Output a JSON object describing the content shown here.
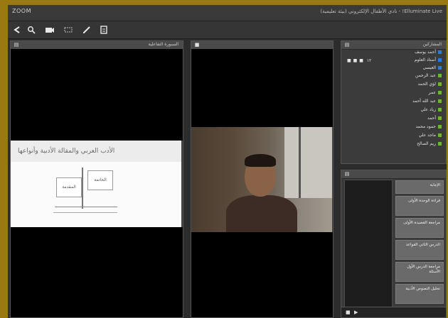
{
  "app": {
    "logo": "ZOOM",
    "title": "Elluminate Live! - نادي الأطفال الإلكتروني (بيئة تعليمية)"
  },
  "toolbar": {
    "icons": [
      "arrow-left-icon",
      "pointer-icon",
      "camera-icon",
      "pen-icon",
      "eraser-icon",
      "clipboard-icon"
    ]
  },
  "whiteboard_panel": {
    "title": "السبورة التفاعلية",
    "slide_title": "الأدب العربي والمقالة الأدبية وأنواعها",
    "slide_box_left": "المقدمة",
    "slide_box_right": "الخاتمة"
  },
  "video_panel": {
    "title": ""
  },
  "participants": {
    "title": "المشاركين",
    "mic_label": "١٢",
    "items": [
      "أحمد يوسف",
      "أستاذ العلوم",
      "العيسى",
      "عبد الرحمن",
      "لؤي الحمد",
      "عمر",
      "عبد الله أحمد",
      "زياد علي",
      "أحمد",
      "حمود محمد",
      "ماجد علي",
      "ريم الصالح"
    ]
  },
  "poll_panel": {
    "title": "",
    "buttons": [
      "الإجابة",
      "قراءة الوحدة الأولى",
      "مراجعة القصيدة الأولى",
      "الدرس الثاني القواعد",
      "مراجعة الدرس الأول الأسئلة",
      "تحليل النصوص الأدبية"
    ]
  }
}
